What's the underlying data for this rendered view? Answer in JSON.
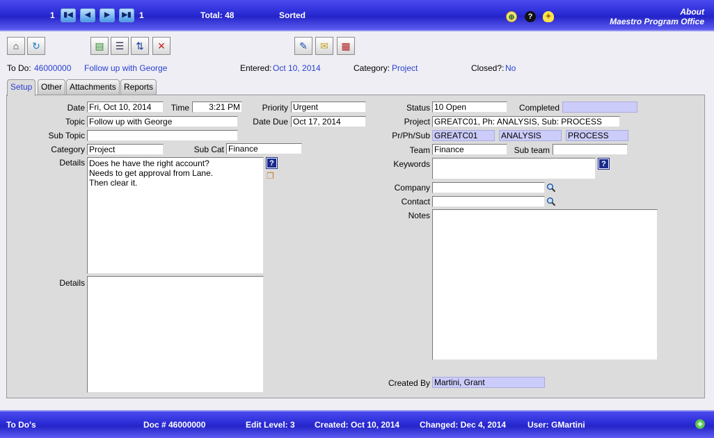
{
  "header": {
    "record_current": "1",
    "record_total_count": "1",
    "total_label": "Total: 48",
    "sorted_label": "Sorted",
    "about_label": "About",
    "app_name": "Maestro Program Office"
  },
  "record_summary": {
    "todo_label": "To Do:",
    "todo_number": "46000000",
    "todo_title": "Follow up with George",
    "entered_label": "Entered:",
    "entered_value": "Oct 10, 2014",
    "category_label": "Category:",
    "category_value": "Project",
    "closed_label": "Closed?:",
    "closed_value": "No"
  },
  "tabs": [
    {
      "label": "Setup"
    },
    {
      "label": "Other"
    },
    {
      "label": "Attachments"
    },
    {
      "label": "Reports"
    }
  ],
  "form": {
    "date_label": "Date",
    "date_value": "Fri, Oct 10, 2014",
    "time_label": "Time",
    "time_value": "3:21 PM",
    "priority_label": "Priority",
    "priority_value": "Urgent",
    "topic_label": "Topic",
    "topic_value": "Follow up with George",
    "date_due_label": "Date Due",
    "date_due_value": "Oct 17, 2014",
    "sub_topic_label": "Sub Topic",
    "sub_topic_value": "",
    "category_label": "Category",
    "category_value": "Project",
    "sub_cat_label": "Sub Cat",
    "sub_cat_value": "Finance",
    "details_label": "Details",
    "details_lines": [
      "Does he have the right account?",
      "Needs to get approval from Lane.",
      "Then clear it."
    ],
    "details2_label": "Details",
    "status_label": "Status",
    "status_value": "10 Open",
    "completed_label": "Completed",
    "completed_value": "",
    "project_label": "Project",
    "project_value": "GREATC01, Ph: ANALYSIS, Sub: PROCESS",
    "prphsub_label": "Pr/Ph/Sub",
    "pr_value": "GREATC01",
    "ph_value": "ANALYSIS",
    "sub_value": "PROCESS",
    "team_label": "Team",
    "team_value": "Finance",
    "sub_team_label": "Sub team",
    "sub_team_value": "",
    "keywords_label": "Keywords",
    "company_label": "Company",
    "contact_label": "Contact",
    "notes_label": "Notes",
    "created_by_label": "Created By",
    "created_by_value": "Martini, Grant"
  },
  "footer": {
    "module": "To Do's",
    "doc": "Doc # 46000000",
    "edit_level": "Edit Level: 3",
    "created": "Created: Oct 10, 2014",
    "changed": "Changed: Dec 4, 2014",
    "user": "User: GMartini"
  },
  "icons": {
    "first": "first-record-icon",
    "prev": "previous-record-icon",
    "next": "next-record-icon",
    "last": "last-record-icon",
    "zoom": "zoom-icon",
    "help": "help-icon",
    "tip": "lightbulb-icon"
  },
  "colors": {
    "bar_blue": "#2c2cd6",
    "link_blue": "#2a3fd0",
    "readonly_field": "#ccccfa",
    "panel_gray": "#dcdcdc"
  }
}
